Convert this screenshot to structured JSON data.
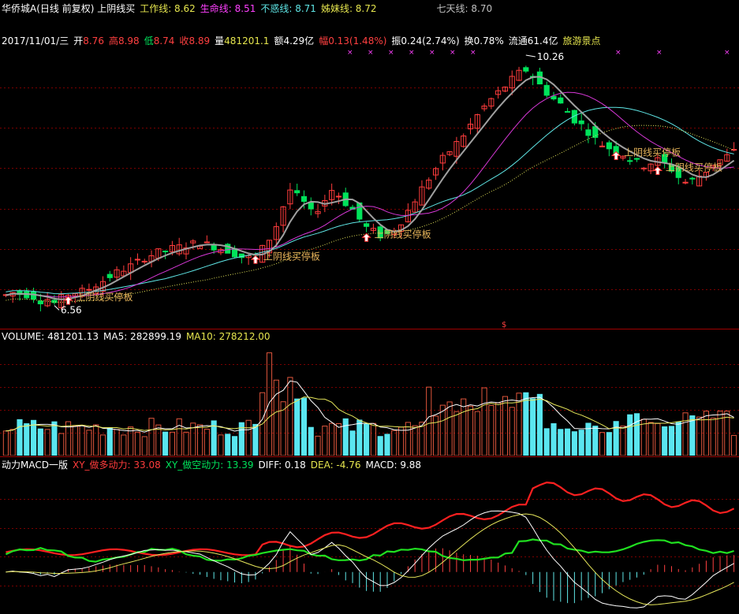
{
  "colors": {
    "background": "#000000",
    "up": "#ff3c3c",
    "down": "#00e35b",
    "grid": "#7a0000",
    "ma_grey": "#a0a0a0",
    "ma_magenta": "#d838d8",
    "ma_cyan": "#5fe6e6",
    "ma_yellow": "#e6e65a",
    "vol_up": "#e0563c",
    "vol_down": "#5ae6f0",
    "annot": "#e6b45a"
  },
  "main_header": {
    "title": "华侨城A(日线 前复权) 上阴线买",
    "lines": [
      {
        "label": "工作线: 8.62",
        "color": "#e6e64e"
      },
      {
        "label": "生命线: 8.51",
        "color": "#ff40ff"
      },
      {
        "label": "不惑线: 8.71",
        "color": "#5fe6e6"
      },
      {
        "label": "姊妹线: 8.72",
        "color": "#e6e64e"
      }
    ],
    "seventh": {
      "label": "七天线: 8.70",
      "color": "#c0c0c0"
    }
  },
  "quote_line": {
    "date": "2017/11/01/三",
    "items": [
      {
        "label": "开",
        "value": "8.76",
        "color": "#ff4040",
        "lcolor": "#ffffff"
      },
      {
        "label": "高",
        "value": "8.98",
        "color": "#ff4040",
        "lcolor": "#ff4040"
      },
      {
        "label": "低",
        "value": "8.74",
        "color": "#ff4040",
        "lcolor": "#00e35b"
      },
      {
        "label": "收",
        "value": "8.89",
        "color": "#ff4040",
        "lcolor": "#ff4040"
      },
      {
        "label": "量",
        "value": "481201.1",
        "color": "#e6e64e",
        "lcolor": "#ffffff"
      },
      {
        "label": "额",
        "value": "4.29亿",
        "color": "#ffffff",
        "lcolor": "#ffffff"
      },
      {
        "label": "幅",
        "value": "0.13(1.48%)",
        "color": "#ff4040",
        "lcolor": "#ff4040"
      },
      {
        "label": "振",
        "value": "0.24(2.74%)",
        "color": "#ffffff",
        "lcolor": "#ffffff"
      },
      {
        "label": "换",
        "value": "0.78%",
        "color": "#ffffff",
        "lcolor": "#ffffff"
      },
      {
        "label": "流通",
        "value": "61.4亿",
        "color": "#ffffff",
        "lcolor": "#ffffff"
      }
    ],
    "sector": "旅游景点"
  },
  "volume_header": {
    "volume": "VOLUME: 481201.13",
    "ma5": "MA5: 282899.19",
    "ma10": "MA10: 278212.00"
  },
  "macd_header": {
    "name": "动力MACD一版",
    "bull": "XY_做多动力: 33.08",
    "bear": "XY_做空动力: 13.39",
    "diff": "DIFF: 0.18",
    "dea": "DEA: -4.76",
    "macd": "MACD: 9.88"
  },
  "chart_data": {
    "type": "candlestick",
    "high_label": "10.26",
    "low_label": "6.56",
    "signal_label": "上阴线买停板",
    "series_price": [
      6.68,
      6.72,
      6.7,
      6.69,
      6.66,
      6.6,
      6.62,
      6.56,
      6.63,
      6.7,
      6.72,
      6.74,
      6.78,
      6.84,
      6.9,
      6.97,
      7.03,
      7.08,
      7.13,
      7.19,
      7.26,
      7.3,
      7.34,
      7.36,
      7.4,
      7.42,
      7.45,
      7.47,
      7.49,
      7.46,
      7.43,
      7.4,
      7.37,
      7.32,
      7.27,
      7.26,
      7.28,
      7.4,
      7.55,
      7.75,
      8.05,
      8.3,
      8.2,
      8.1,
      7.95,
      8.02,
      8.15,
      8.3,
      8.22,
      8.1,
      8.0,
      7.85,
      7.72,
      7.66,
      7.6,
      7.62,
      7.7,
      7.82,
      7.98,
      8.15,
      8.32,
      8.48,
      8.63,
      8.78,
      8.9,
      9.02,
      9.15,
      9.3,
      9.45,
      9.58,
      9.7,
      9.8,
      9.9,
      10.0,
      10.1,
      10.15,
      10.05,
      9.92,
      9.8,
      9.7,
      9.62,
      9.5,
      9.38,
      9.3,
      9.2,
      9.08,
      9.0,
      8.95,
      8.9,
      8.85,
      8.78,
      8.72,
      8.68,
      8.72,
      8.76,
      8.7,
      8.62,
      8.5,
      8.42,
      8.45,
      8.52,
      8.6,
      8.7,
      8.76,
      8.82,
      8.89
    ],
    "volume_scale_max": 1000000,
    "macd_axis": {
      "min": -20,
      "max": 50
    }
  }
}
